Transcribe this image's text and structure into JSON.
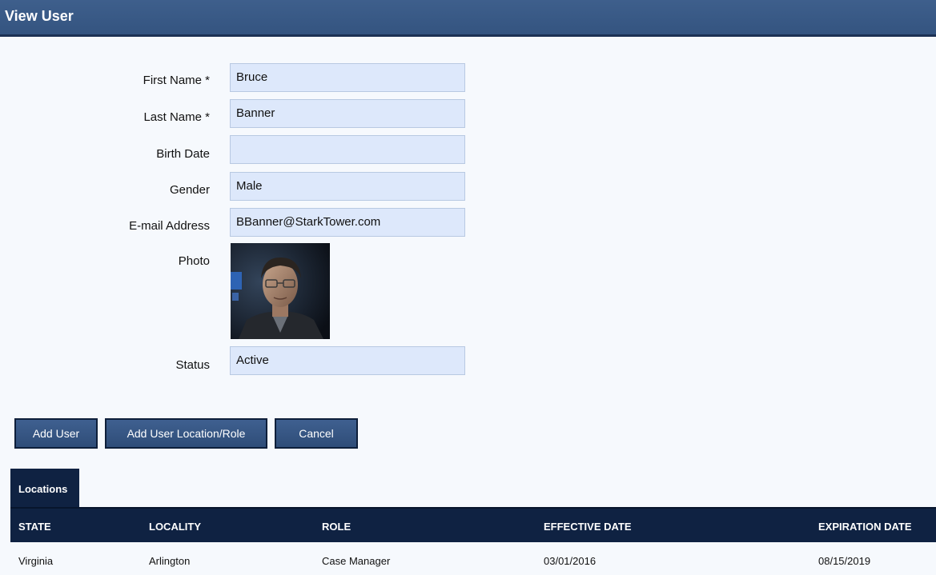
{
  "window": {
    "title": "View User"
  },
  "form": {
    "first_name": {
      "label": "First Name *",
      "value": "Bruce"
    },
    "last_name": {
      "label": "Last Name *",
      "value": "Banner"
    },
    "birth_date": {
      "label": "Birth Date",
      "value": ""
    },
    "gender": {
      "label": "Gender",
      "value": "Male"
    },
    "email": {
      "label": "E-mail Address",
      "value": "BBanner@StarkTower.com"
    },
    "photo": {
      "label": "Photo"
    },
    "status": {
      "label": "Status",
      "value": "Active"
    }
  },
  "buttons": {
    "add_user": "Add User",
    "add_location_role": "Add User Location/Role",
    "cancel": "Cancel"
  },
  "tabs": [
    {
      "label": "Locations",
      "active": true
    }
  ],
  "table": {
    "columns": [
      "STATE",
      "LOCALITY",
      "ROLE",
      "EFFECTIVE DATE",
      "EXPIRATION DATE"
    ],
    "rows": [
      [
        "Virginia",
        "Arlington",
        "Case Manager",
        "03/01/2016",
        "08/15/2019"
      ]
    ]
  },
  "colors": {
    "header_blue": "#345480",
    "dark_navy": "#0f2242",
    "field_bg": "#dde8fb",
    "page_bg": "#f6f9fd"
  }
}
